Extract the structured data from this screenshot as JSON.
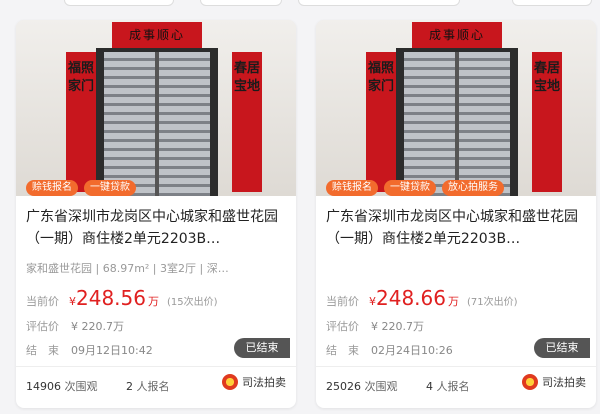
{
  "cards": [
    {
      "banner": "成事顺心",
      "couplet_left": "福照家门",
      "couplet_right": "春居宝地",
      "tags": [
        "赊钱报名",
        "一键贷款"
      ],
      "title": "广东省深圳市龙岗区中心城家和盛世花园（一期）商住楼2单元2203B…",
      "meta": "家和盛世花园 | 68.97m² | 3室2厅 | 深…",
      "price_label": "当前价",
      "currency": "¥",
      "price": "248.56",
      "price_unit": "万",
      "bids": "(15次出价)",
      "eval_label": "评估价",
      "eval_value": "¥ 220.7万",
      "end_label": "结　束",
      "end_value": "09月12日10:42",
      "status": "已结束",
      "views_num": "14906",
      "views_label": "次围观",
      "signups_num": "2",
      "signups_label": "人报名",
      "source": "司法拍卖"
    },
    {
      "banner": "成事顺心",
      "couplet_left": "福照家门",
      "couplet_right": "春居宝地",
      "tags": [
        "赊钱报名",
        "一键贷款",
        "放心拍服务"
      ],
      "title": "广东省深圳市龙岗区中心城家和盛世花园（一期）商住楼2单元2203B…",
      "meta": "",
      "price_label": "当前价",
      "currency": "¥",
      "price": "248.66",
      "price_unit": "万",
      "bids": "(71次出价)",
      "eval_label": "评估价",
      "eval_value": "¥ 220.7万",
      "end_label": "结　束",
      "end_value": "02月24日10:26",
      "status": "已结束",
      "views_num": "25026",
      "views_label": "次围观",
      "signups_num": "4",
      "signups_label": "人报名",
      "source": "司法拍卖"
    }
  ],
  "colors": {
    "accent": "#f26b2d",
    "price": "#e02020",
    "status_bg": "#555555"
  }
}
